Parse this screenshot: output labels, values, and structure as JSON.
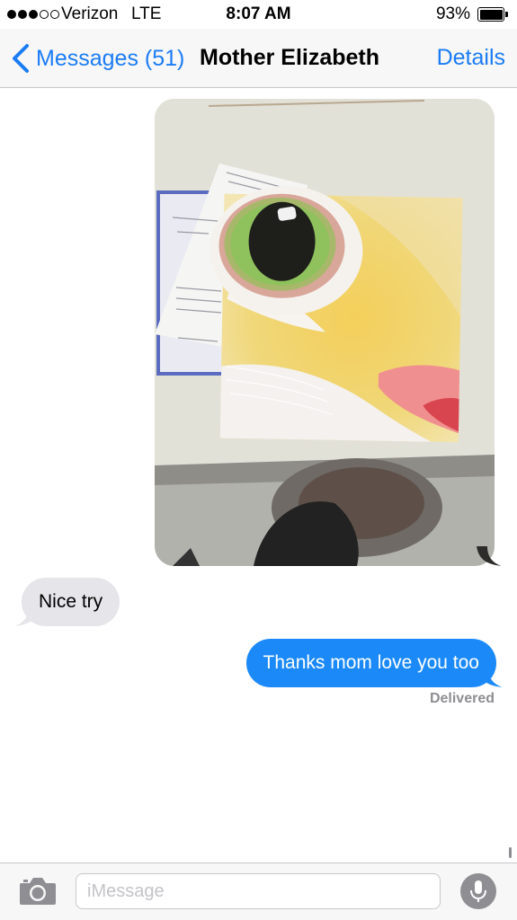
{
  "status_bar": {
    "carrier": "Verizon",
    "network": "LTE",
    "time": "8:07 AM",
    "battery_percent": "93%",
    "battery_level": 0.93,
    "signal_bars_filled": 3,
    "signal_bars_total": 5
  },
  "nav": {
    "back_label": "Messages (51)",
    "contact_name": "Mother Elizabeth",
    "details_label": "Details"
  },
  "messages": [
    {
      "type": "photo",
      "direction": "outgoing",
      "content": "photo of a painted cat face close-up with a green eye on a table"
    },
    {
      "type": "text",
      "direction": "incoming",
      "text": "Nice try"
    },
    {
      "type": "text",
      "direction": "outgoing",
      "text": "Thanks mom love you too"
    }
  ],
  "receipt": "Delivered",
  "input": {
    "placeholder": "iMessage",
    "value": ""
  },
  "icons": {
    "back": "chevron-left-icon",
    "camera": "camera-icon",
    "mic": "microphone-icon"
  },
  "colors": {
    "accent": "#1b7cf5",
    "outgoing_bubble": "#1b8af8",
    "incoming_bubble": "#e5e5ea",
    "receipt_text": "#8e8e93"
  }
}
